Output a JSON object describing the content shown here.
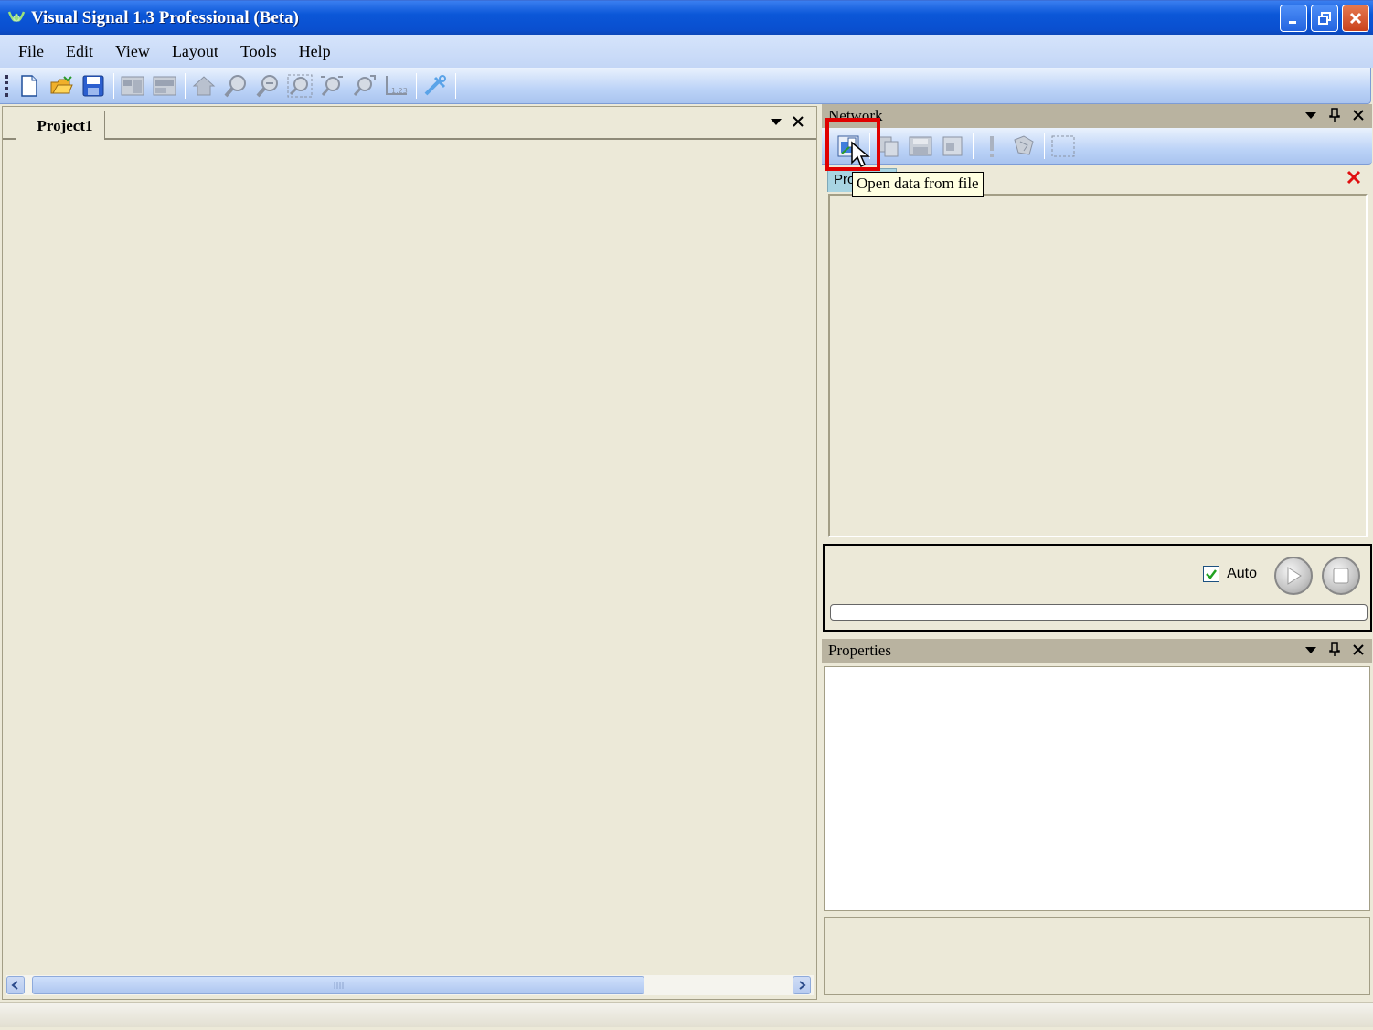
{
  "window": {
    "title": "Visual Signal 1.3 Professional (Beta)"
  },
  "menu": {
    "items": [
      "File",
      "Edit",
      "View",
      "Layout",
      "Tools",
      "Help"
    ]
  },
  "toolbar": {
    "icons": [
      "new-icon",
      "open-icon",
      "save-icon",
      "layout-icon",
      "layout2-icon",
      "home-icon",
      "zoom-in-icon",
      "zoom-out-icon",
      "zoom-fit-icon",
      "zoom-region-icon",
      "zoom-reset-icon",
      "axis-icon",
      "settings-icon"
    ]
  },
  "document": {
    "tab_label": "Project1"
  },
  "network_panel": {
    "title": "Network",
    "tab_label": "Pro",
    "tooltip": "Open data from file"
  },
  "run_panel": {
    "auto_label": "Auto",
    "auto_checked": true,
    "progress": 0
  },
  "properties_panel": {
    "title": "Properties"
  },
  "colors": {
    "titlebar": "#0b57d8",
    "highlight": "#e00000",
    "panel_bg": "#ece9d8"
  }
}
